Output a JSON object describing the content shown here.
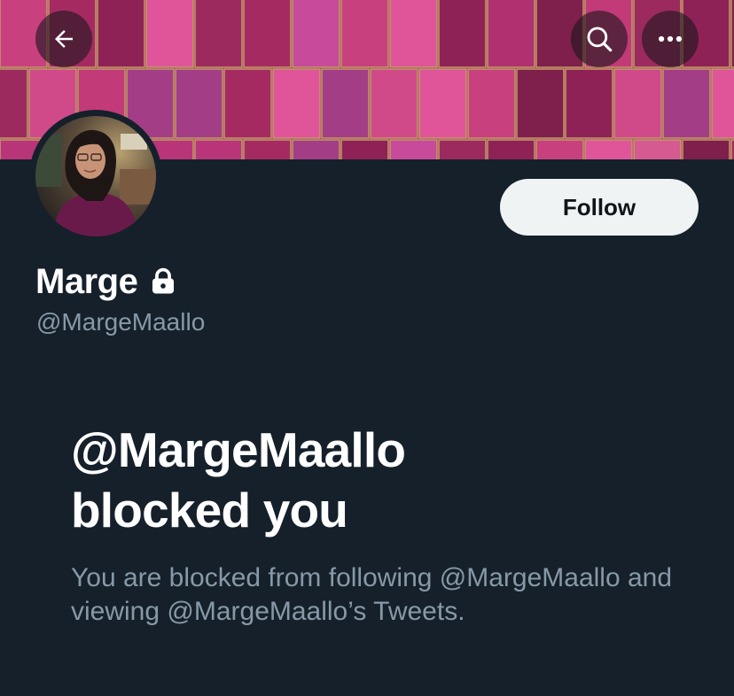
{
  "banner": {
    "tile_colors": [
      "#c23a78",
      "#a52a62",
      "#d04a8a",
      "#8e2256",
      "#b8357a",
      "#e0559a",
      "#9c2a5e",
      "#c8407e",
      "#7e1f4c",
      "#d65a92",
      "#b03070",
      "#c84a9a",
      "#a33e86"
    ]
  },
  "nav": {
    "back_icon": "arrow-left-icon",
    "search_icon": "search-icon",
    "more_icon": "more-horizontal-icon"
  },
  "profile": {
    "display_name": "Marge",
    "handle": "@MargeMaallo",
    "protected_icon": "lock-icon",
    "follow_label": "Follow"
  },
  "blocked": {
    "title_line1": "@MargeMaallo",
    "title_line2": "blocked you",
    "description": "You are blocked from following @MargeMaallo and viewing @MargeMaallo’s Tweets."
  },
  "colors": {
    "background": "#15202b",
    "primary_text": "#ffffff",
    "secondary_text": "#8899a6",
    "follow_bg": "#eff3f4"
  }
}
